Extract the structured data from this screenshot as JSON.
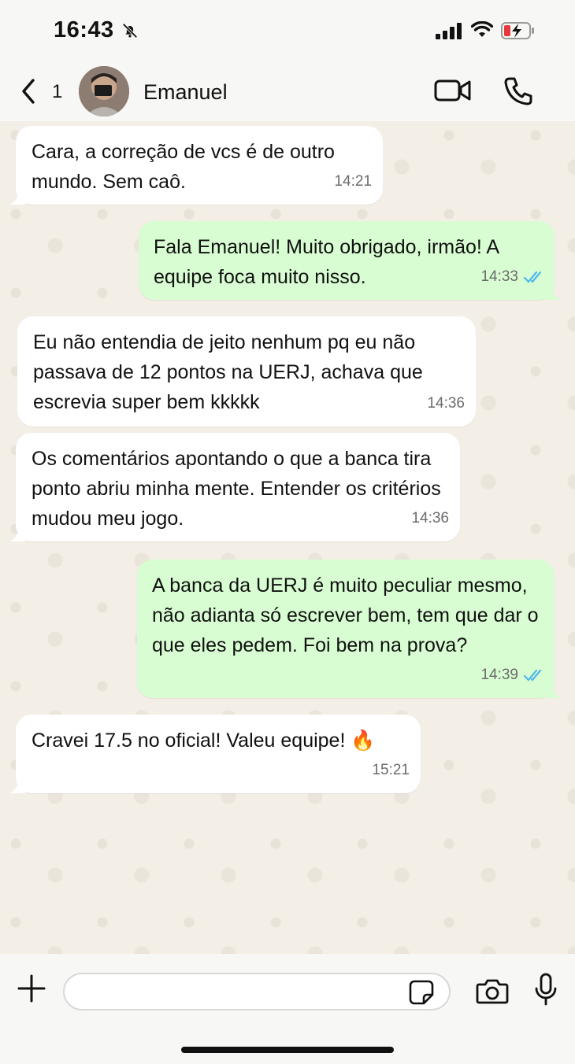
{
  "status_bar": {
    "time": "16:43"
  },
  "header": {
    "unread_count": "1",
    "contact_name": "Emanuel"
  },
  "messages": [
    {
      "direction": "in",
      "text": "Cara, a correção de vcs é de outro mundo. Sem caô.",
      "time": "14:21"
    },
    {
      "direction": "out",
      "text": "Fala Emanuel! Muito obrigado, irmão! A equipe foca muito nisso.",
      "time": "14:33",
      "read": true
    },
    {
      "direction": "in",
      "text": "Eu não entendia de jeito nenhum pq eu não passava de 12 pontos na UERJ, achava que escrevia super bem kkkkk",
      "time": "14:36"
    },
    {
      "direction": "in",
      "text": "Os comentários apontando o que a banca tira ponto abriu minha mente. Entender os critérios mudou meu jogo.",
      "time": "14:36"
    },
    {
      "direction": "out",
      "text": "A banca da UERJ é muito peculiar mesmo, não adianta só escrever bem, tem que dar o que eles pedem. Foi bem na prova?",
      "time": "14:39",
      "read": true
    },
    {
      "direction": "in",
      "text": "Cravei 17.5 no oficial! Valeu equipe! 🔥",
      "time": "15:21"
    }
  ],
  "composer": {
    "value": "",
    "placeholder": ""
  },
  "colors": {
    "incoming_bubble": "#ffffff",
    "outgoing_bubble": "#d8fdd2",
    "read_ticks": "#4fb6ec",
    "wallpaper": "#f3eee6"
  }
}
